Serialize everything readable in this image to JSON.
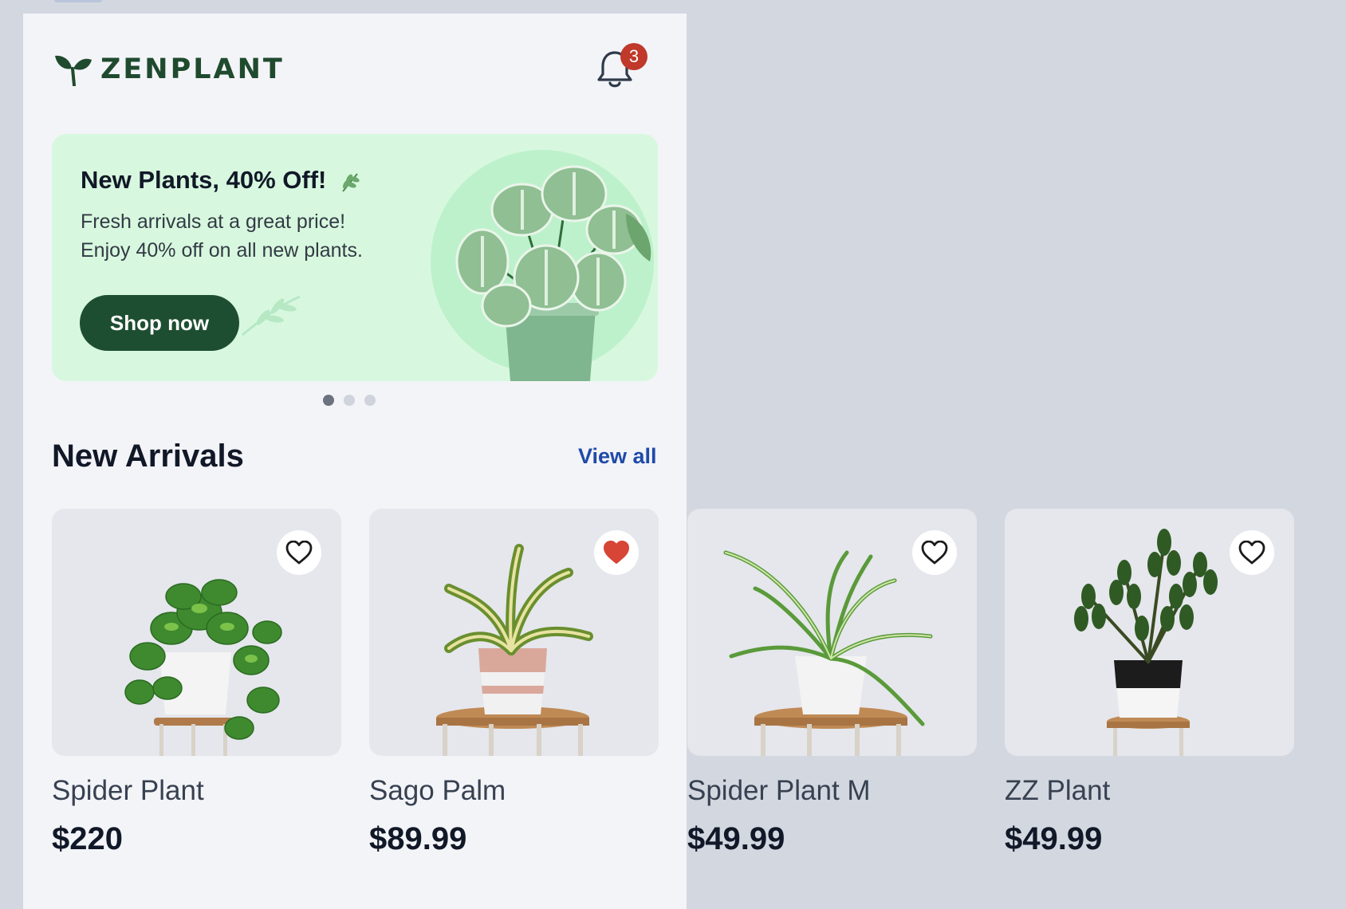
{
  "brand": {
    "name": "ZENPLANT"
  },
  "header": {
    "notification_count": "3"
  },
  "banner": {
    "title": "New Plants, 40% Off!",
    "subtitle_line1": "Fresh arrivals at a great price!",
    "subtitle_line2": "Enjoy 40% off on all new plants.",
    "cta_label": "Shop now",
    "carousel_dots": 3,
    "active_dot": 1
  },
  "section": {
    "title": "New Arrivals",
    "view_all_label": "View all"
  },
  "products": [
    {
      "name": "Spider Plant",
      "price": "$220",
      "favorited": false
    },
    {
      "name": "Sago Palm",
      "price": "$89.99",
      "favorited": true
    },
    {
      "name": "Spider Plant  M",
      "price": "$49.99",
      "favorited": false
    },
    {
      "name": "ZZ Plant",
      "price": "$49.99",
      "favorited": false
    }
  ],
  "colors": {
    "brand_green": "#1f4a2e",
    "banner_bg": "#d7f8df",
    "link_blue": "#1f4aa8",
    "badge_red": "#c0392b",
    "heart_red": "#d64535"
  }
}
